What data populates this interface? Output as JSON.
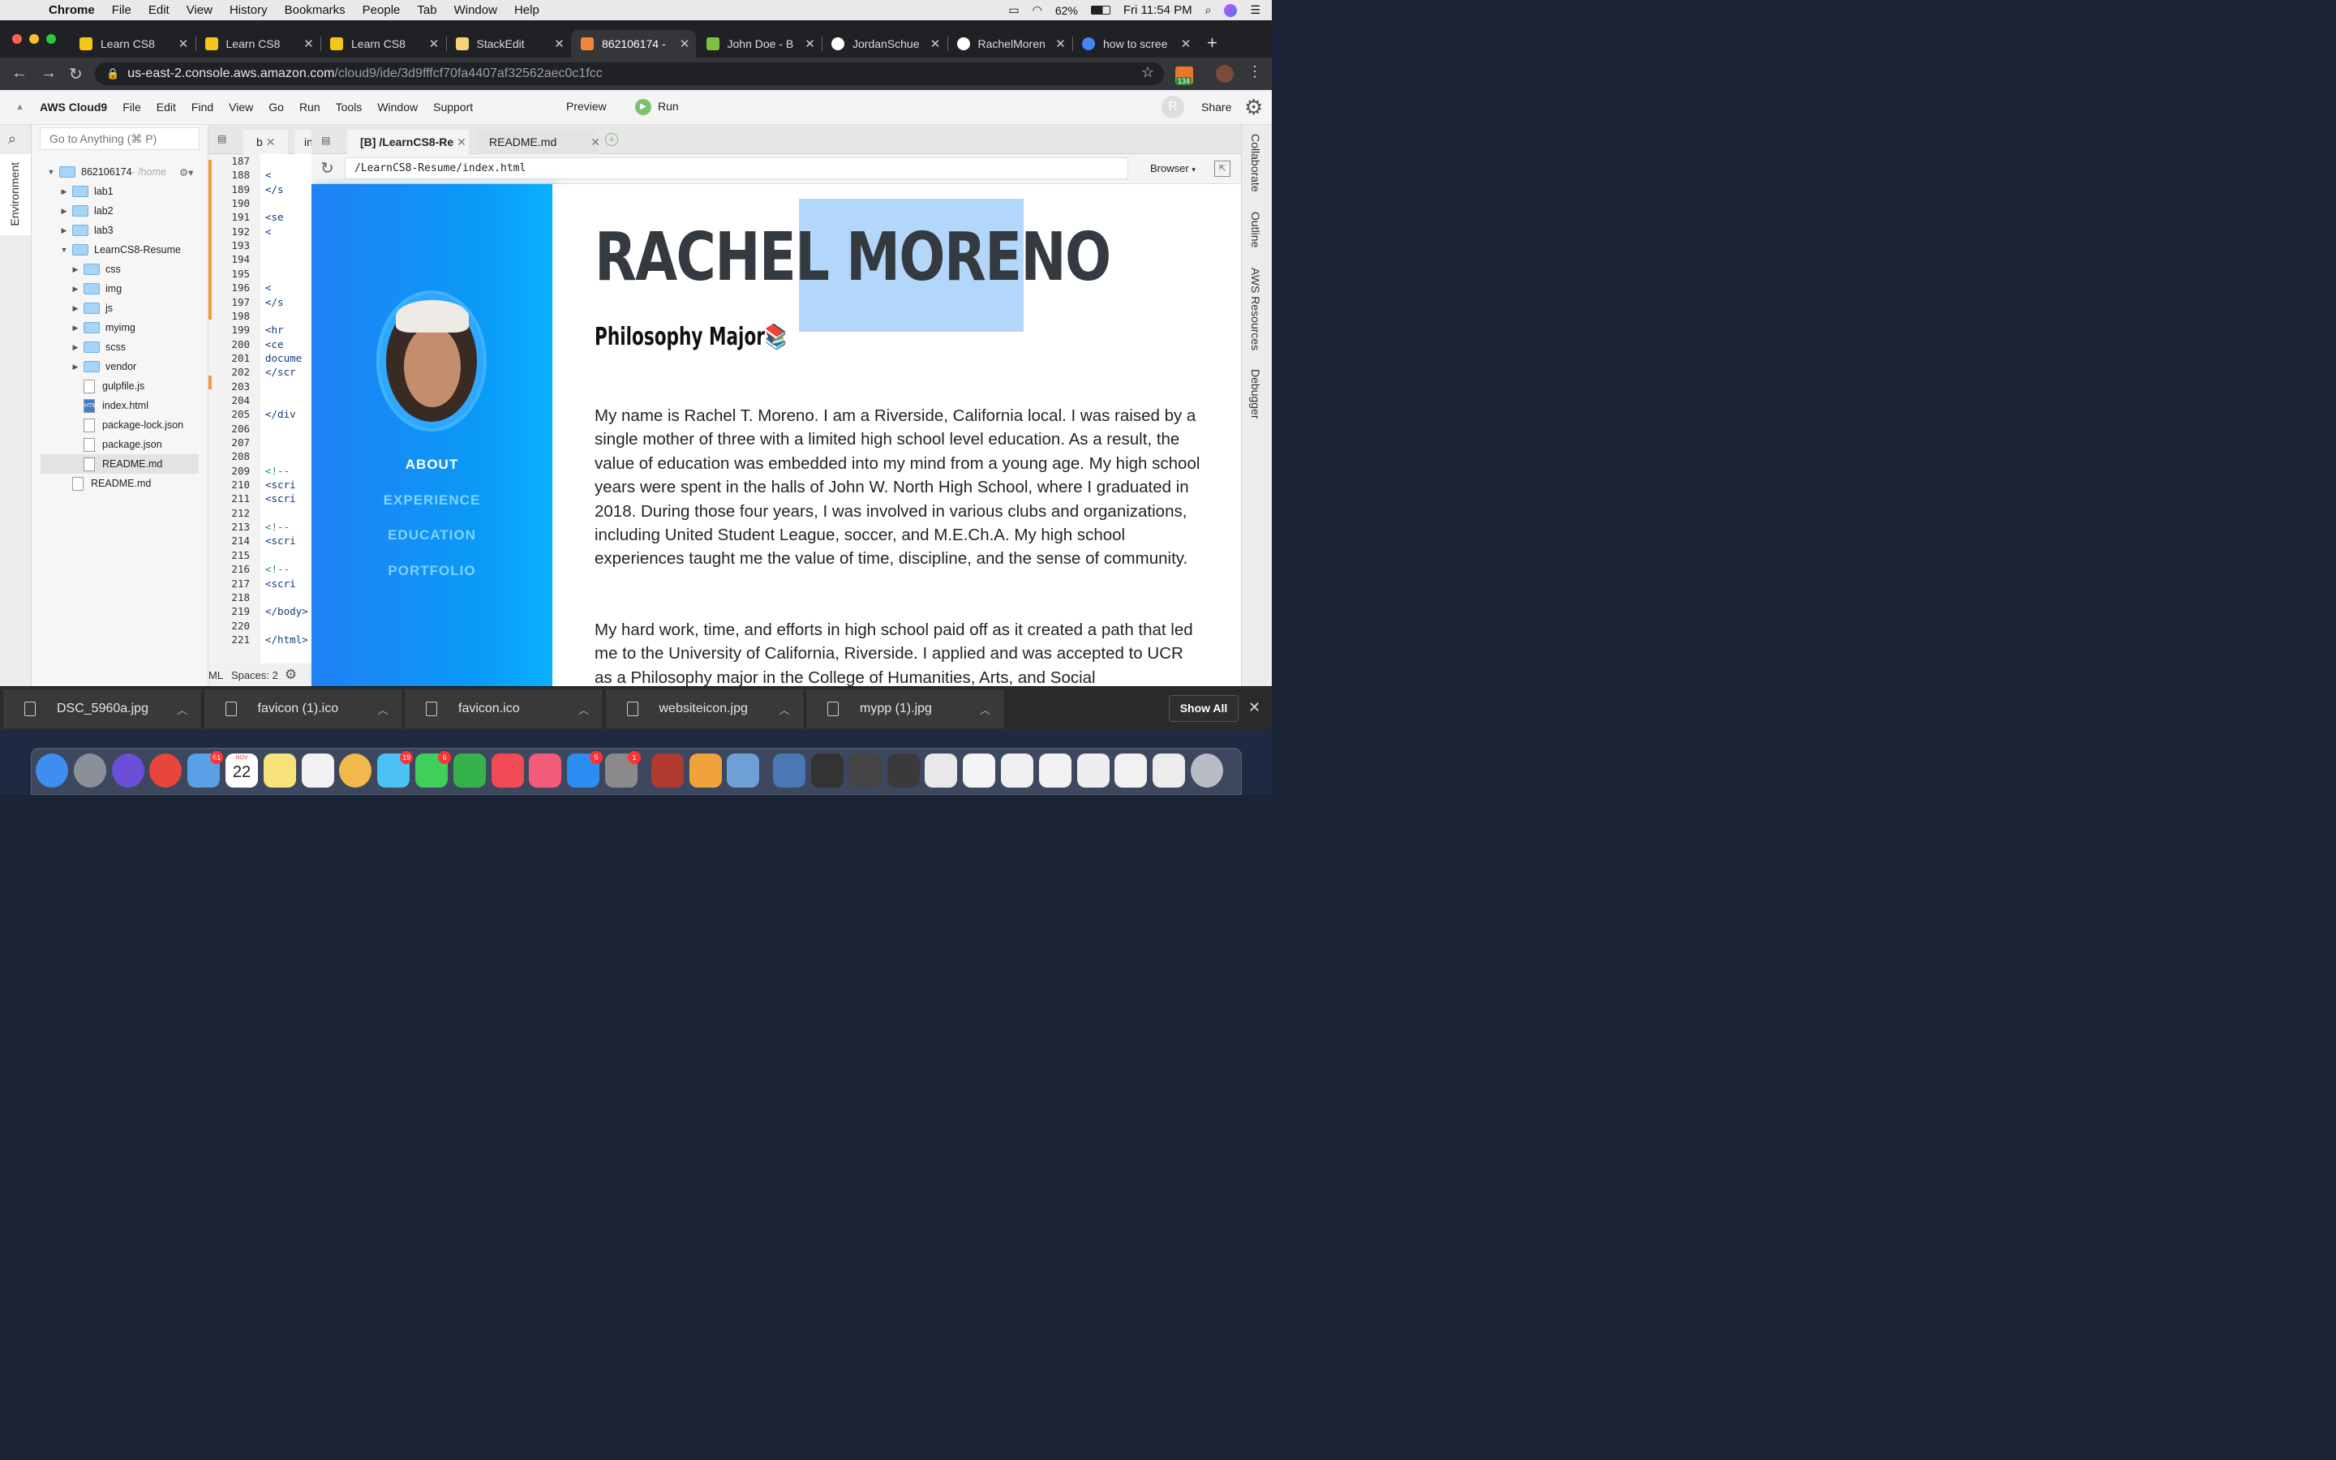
{
  "menubar": {
    "app": "Chrome",
    "items": [
      "File",
      "Edit",
      "View",
      "History",
      "Bookmarks",
      "People",
      "Tab",
      "Window",
      "Help"
    ],
    "battery": "62%",
    "clock": "Fri 11:54 PM"
  },
  "tabs": [
    {
      "title": "Learn CS8",
      "icon": "learncs8-favicon",
      "color": "#f5c518"
    },
    {
      "title": "Learn CS8",
      "icon": "learncs8-favicon",
      "color": "#f5c518"
    },
    {
      "title": "Learn CS8",
      "icon": "learncs8-favicon",
      "color": "#f5c518"
    },
    {
      "title": "StackEdit",
      "icon": "stackedit-favicon",
      "color": "#f3d27a"
    },
    {
      "title": "862106174 - ",
      "icon": "aws-favicon",
      "color": "#f58536",
      "active": true
    },
    {
      "title": "John Doe - B",
      "icon": "avocado-favicon",
      "color": "#7fbf3f"
    },
    {
      "title": "JordanSchue",
      "icon": "github-favicon",
      "color": "#ffffff"
    },
    {
      "title": "RachelMoren",
      "icon": "github-favicon",
      "color": "#ffffff"
    },
    {
      "title": "how to scree",
      "icon": "google-favicon",
      "color": "#4285f4"
    }
  ],
  "address": {
    "host": "us-east-2.console.aws.amazon.com",
    "path": "/cloud9/ide/3d9fffcf70fa4407af32562aec0c1fcc",
    "ext_badge": "134"
  },
  "c9": {
    "brand": "AWS Cloud9",
    "menu": [
      "File",
      "Edit",
      "Find",
      "View",
      "Go",
      "Run",
      "Tools",
      "Window",
      "Support"
    ],
    "preview": "Preview",
    "run": "Run",
    "avatar": "R",
    "share": "Share"
  },
  "left_strip": {
    "environment": "Environment"
  },
  "tree": {
    "search_placeholder": "Go to Anything (⌘ P)",
    "root": "862106174",
    "root_suffix": " - /home",
    "items": [
      {
        "name": "lab1",
        "type": "folder",
        "depth": 1
      },
      {
        "name": "lab2",
        "type": "folder",
        "depth": 1
      },
      {
        "name": "lab3",
        "type": "folder",
        "depth": 1
      },
      {
        "name": "LearnCS8-Resume",
        "type": "folder",
        "depth": 1,
        "open": true
      },
      {
        "name": "css",
        "type": "folder",
        "depth": 2
      },
      {
        "name": "img",
        "type": "folder",
        "depth": 2
      },
      {
        "name": "js",
        "type": "folder",
        "depth": 2
      },
      {
        "name": "myimg",
        "type": "folder",
        "depth": 2
      },
      {
        "name": "scss",
        "type": "folder",
        "depth": 2
      },
      {
        "name": "vendor",
        "type": "folder",
        "depth": 2
      },
      {
        "name": "gulpfile.js",
        "type": "file",
        "depth": 2
      },
      {
        "name": "index.html",
        "type": "file",
        "depth": 2,
        "tag": "HTML"
      },
      {
        "name": "package-lock.json",
        "type": "file",
        "depth": 2
      },
      {
        "name": "package.json",
        "type": "file",
        "depth": 2
      },
      {
        "name": "README.md",
        "type": "file",
        "depth": 2,
        "selected": true
      },
      {
        "name": "README.md",
        "type": "file",
        "depth": 1
      }
    ]
  },
  "editor": {
    "tabs": [
      "b",
      "in"
    ],
    "lines": [
      {
        "n": "187",
        "code": ""
      },
      {
        "n": "188",
        "code": "      <"
      },
      {
        "n": "189",
        "code": "    </s"
      },
      {
        "n": "190",
        "code": ""
      },
      {
        "n": "191",
        "code": "    <se"
      },
      {
        "n": "192",
        "code": "      <"
      },
      {
        "n": "193",
        "code": ""
      },
      {
        "n": "194",
        "code": ""
      },
      {
        "n": "195",
        "code": ""
      },
      {
        "n": "196",
        "code": "      <"
      },
      {
        "n": "197",
        "code": "    </s"
      },
      {
        "n": "198",
        "code": ""
      },
      {
        "n": "199",
        "code": "    <hr"
      },
      {
        "n": "200",
        "code": "    <ce"
      },
      {
        "n": "201",
        "code": "  docume"
      },
      {
        "n": "202",
        "code": "  </scr"
      },
      {
        "n": "203",
        "code": ""
      },
      {
        "n": "204",
        "code": ""
      },
      {
        "n": "205",
        "code": "  </div"
      },
      {
        "n": "206",
        "code": ""
      },
      {
        "n": "207",
        "code": ""
      },
      {
        "n": "208",
        "code": ""
      },
      {
        "n": "209",
        "code": "  <!-- "
      },
      {
        "n": "210",
        "code": "  <scri"
      },
      {
        "n": "211",
        "code": "  <scri"
      },
      {
        "n": "212",
        "code": ""
      },
      {
        "n": "213",
        "code": "  <!-- "
      },
      {
        "n": "214",
        "code": "  <scri"
      },
      {
        "n": "215",
        "code": ""
      },
      {
        "n": "216",
        "code": "  <!-- "
      },
      {
        "n": "217",
        "code": "  <scri"
      },
      {
        "n": "218",
        "code": ""
      },
      {
        "n": "219",
        "code": "</body>"
      },
      {
        "n": "220",
        "code": ""
      },
      {
        "n": "221",
        "code": "</html>"
      }
    ],
    "mode": "ML",
    "spaces": "Spaces: 2"
  },
  "preview": {
    "tab_active": "[B] /LearnCS8-Re",
    "tab_other": "README.md",
    "url": "/LearnCS8-Resume/index.html",
    "browser_select": "Browser",
    "nav": [
      "ABOUT",
      "EXPERIENCE",
      "EDUCATION",
      "PORTFOLIO"
    ],
    "first_name": "RACHEL",
    "last_name": "MORENO",
    "subtitle": "Philosophy Major📚",
    "para1": "My name is Rachel T. Moreno. I am a Riverside, California local. I was raised by a single mother of three with a limited high school level education. As a result, the value of education was embedded into my mind from a young age. My high school years were spent in the halls of John W. North High School, where I graduated in 2018. During those four years, I was involved in various clubs and organizations, including United Student League, soccer, and M.E.Ch.A. My high school experiences taught me the value of time, discipline, and the sense of community.",
    "para2": "My hard work, time, and efforts in high school paid off as it created a path that led me to the University of California, Riverside. I applied and was accepted to UCR as a Philosophy major in the College of Humanities, Arts, and Social"
  },
  "right_strip": [
    "Collaborate",
    "Outline",
    "AWS Resources",
    "Debugger"
  ],
  "downloads": {
    "items": [
      "DSC_5960a.jpg",
      "favicon (1).ico",
      "favicon.ico",
      "websiteicon.jpg",
      "mypp (1).jpg"
    ],
    "show_all": "Show All"
  },
  "dock": {
    "apps": [
      {
        "name": "finder",
        "color": "#3d8ef0"
      },
      {
        "name": "launchpad",
        "color": "#8a8f99"
      },
      {
        "name": "siri",
        "color": "#6b4fd8"
      },
      {
        "name": "chrome",
        "color": "#e8453c"
      },
      {
        "name": "mail",
        "color": "#5aa0e6",
        "badge": "61"
      },
      {
        "name": "calendar",
        "color": "#ffffff",
        "label": "22",
        "month": "NOV"
      },
      {
        "name": "notes",
        "color": "#f7e27a"
      },
      {
        "name": "reminders",
        "color": "#f2f2f2"
      },
      {
        "name": "photos",
        "color": "#f2b84b"
      },
      {
        "name": "messages",
        "color": "#4bc1f5",
        "badge": "19"
      },
      {
        "name": "facetime",
        "color": "#3fcf5b",
        "badge": "6"
      },
      {
        "name": "numbers",
        "color": "#35b24a"
      },
      {
        "name": "news",
        "color": "#f24a55"
      },
      {
        "name": "music",
        "color": "#f25b7a"
      },
      {
        "name": "app-store",
        "color": "#2b8cf2",
        "badge": "5"
      },
      {
        "name": "system-preferences",
        "color": "#8a8a8a",
        "badge": "1"
      },
      {
        "name": "dictionary",
        "color": "#b03a2e"
      },
      {
        "name": "pages",
        "color": "#f0a33c"
      },
      {
        "name": "preview",
        "color": "#6e9fd6"
      },
      {
        "name": "recent-image",
        "color": "#4a78b5"
      },
      {
        "name": "recent-doc",
        "color": "#333333"
      },
      {
        "name": "recent-doc",
        "color": "#444444"
      },
      {
        "name": "recent-doc",
        "color": "#3a3a3a"
      },
      {
        "name": "recent-doc",
        "color": "#e8e8e8"
      },
      {
        "name": "recent-doc",
        "color": "#f4f4f4"
      },
      {
        "name": "recent-doc",
        "color": "#efefef"
      },
      {
        "name": "recent-doc",
        "color": "#f2f2f2"
      },
      {
        "name": "recent-doc",
        "color": "#eeeeee"
      },
      {
        "name": "recent-doc",
        "color": "#f1f1f1"
      },
      {
        "name": "recent-doc",
        "color": "#ececec"
      },
      {
        "name": "trash",
        "color": "#b8bcc4"
      }
    ]
  }
}
